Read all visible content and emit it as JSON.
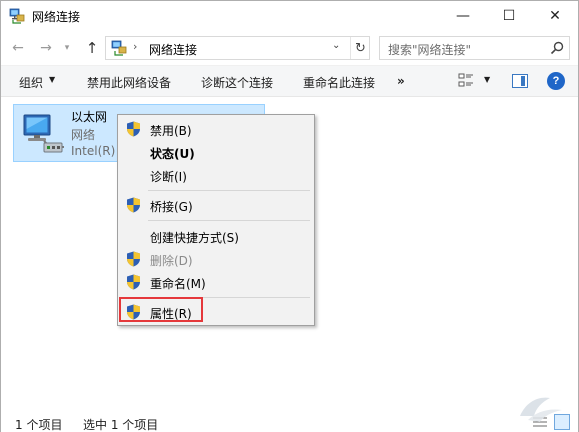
{
  "window": {
    "title": "网络连接",
    "icon": "network-connections-icon",
    "controls": {
      "minimize": "—",
      "maximize": "☐",
      "close": "✕"
    }
  },
  "address": {
    "path": "网络连接",
    "separator": "›",
    "search_placeholder": "搜索\"网络连接\""
  },
  "toolbar": {
    "organize": "组织",
    "disable": "禁用此网络设备",
    "diagnose": "诊断这个连接",
    "rename": "重命名此连接",
    "more": "»",
    "help": "?"
  },
  "items": [
    {
      "name": "以太网",
      "status": "网络",
      "device": "Intel(R)",
      "icon": "ethernet-adapter-icon",
      "selected": true
    }
  ],
  "context_menu": {
    "items": [
      {
        "label": "禁用(B)",
        "shield": true,
        "bold": false,
        "disabled": false
      },
      {
        "label": "状态(U)",
        "shield": false,
        "bold": true,
        "disabled": false
      },
      {
        "label": "诊断(I)",
        "shield": false,
        "bold": false,
        "disabled": false
      },
      {
        "label": "桥接(G)",
        "shield": true,
        "bold": false,
        "disabled": false
      },
      {
        "label": "创建快捷方式(S)",
        "shield": false,
        "bold": false,
        "disabled": false
      },
      {
        "label": "删除(D)",
        "shield": true,
        "bold": false,
        "disabled": true
      },
      {
        "label": "重命名(M)",
        "shield": true,
        "bold": false,
        "disabled": false
      },
      {
        "label": "属性(R)",
        "shield": true,
        "bold": false,
        "disabled": false,
        "highlighted": true
      }
    ],
    "highlight_color": "#e5383b"
  },
  "status": {
    "count": "1 个项目",
    "selected": "选中 1 个项目"
  },
  "colors": {
    "selection_bg": "#cce8ff",
    "selection_border": "#99d1ff",
    "help_blue": "#1f66c8"
  }
}
